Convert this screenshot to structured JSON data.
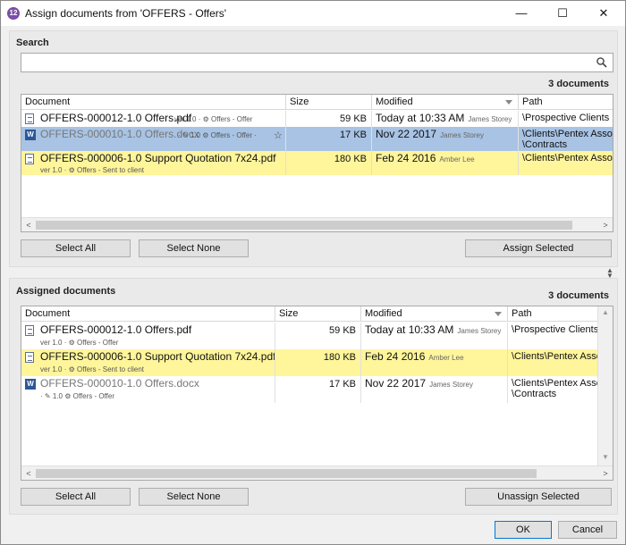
{
  "window": {
    "title": "Assign documents from 'OFFERS - Offers'",
    "app_icon_text": "12",
    "minimize": "—",
    "maximize": "☐",
    "close": "✕"
  },
  "search": {
    "label": "Search",
    "value": "",
    "placeholder": "",
    "count": "3 documents",
    "columns": [
      "Document",
      "Size",
      "Modified",
      "Path"
    ],
    "rows": [
      {
        "name": "OFFERS-000012-1.0 Offers.pdf",
        "version": "ver 1.0",
        "sep": "·",
        "workflow": "Offers - Offer",
        "size": "59 KB",
        "modified": "Today at 10:33 AM",
        "author": "James Storey",
        "path1": "\\Prospective Clients",
        "path2": ""
      },
      {
        "name": "OFFERS-000010-1.0 Offers.docx",
        "version": "1.0",
        "sep": "·",
        "workflow": "Offers - Offer",
        "star": "☆",
        "size": "17 KB",
        "modified": "Nov 22 2017",
        "author": "James Storey",
        "path1": "\\Clients\\Pentex Assoc",
        "path2": "\\Contracts"
      },
      {
        "name": "OFFERS-000006-1.0 Support Quotation 7x24.pdf",
        "version": "ver 1.0",
        "sep": "·",
        "workflow": "Offers - Sent to client",
        "size": "180 KB",
        "modified": "Feb 24 2016",
        "author": "Amber Lee",
        "path1": "\\Clients\\Pentex Asso",
        "path2": ""
      }
    ],
    "buttons": {
      "select_all": "Select All",
      "select_none": "Select None",
      "assign_selected": "Assign Selected"
    }
  },
  "assigned": {
    "label": "Assigned documents",
    "count": "3 documents",
    "columns": [
      "Document",
      "Size",
      "Modified",
      "Path"
    ],
    "rows": [
      {
        "name": "OFFERS-000012-1.0 Offers.pdf",
        "version": "ver 1.0",
        "sep": "·",
        "workflow": "Offers - Offer",
        "size": "59 KB",
        "modified": "Today at 10:33 AM",
        "author": "James Storey",
        "path1": "\\Prospective Clients",
        "path2": ""
      },
      {
        "name": "OFFERS-000006-1.0 Support Quotation 7x24.pdf",
        "version": "ver 1.0",
        "sep": "·",
        "workflow": "Offers - Sent to client",
        "size": "180 KB",
        "modified": "Feb 24 2016",
        "author": "Amber Lee",
        "path1": "\\Clients\\Pentex Associ",
        "path2": ""
      },
      {
        "name": "OFFERS-000010-1.0 Offers.docx",
        "version": "1.0",
        "sep": "·",
        "workflow": "Offers - Offer",
        "size": "17 KB",
        "modified": "Nov 22 2017",
        "author": "James Storey",
        "path1": "\\Clients\\Pentex Associ",
        "path2": "\\Contracts"
      }
    ],
    "buttons": {
      "select_all": "Select All",
      "select_none": "Select None",
      "unassign_selected": "Unassign Selected"
    }
  },
  "footer": {
    "ok": "OK",
    "cancel": "Cancel"
  },
  "colors": {
    "selected_row": "#a8c3e4",
    "highlight_row": "#fff59b",
    "accent": "#0078d7"
  }
}
